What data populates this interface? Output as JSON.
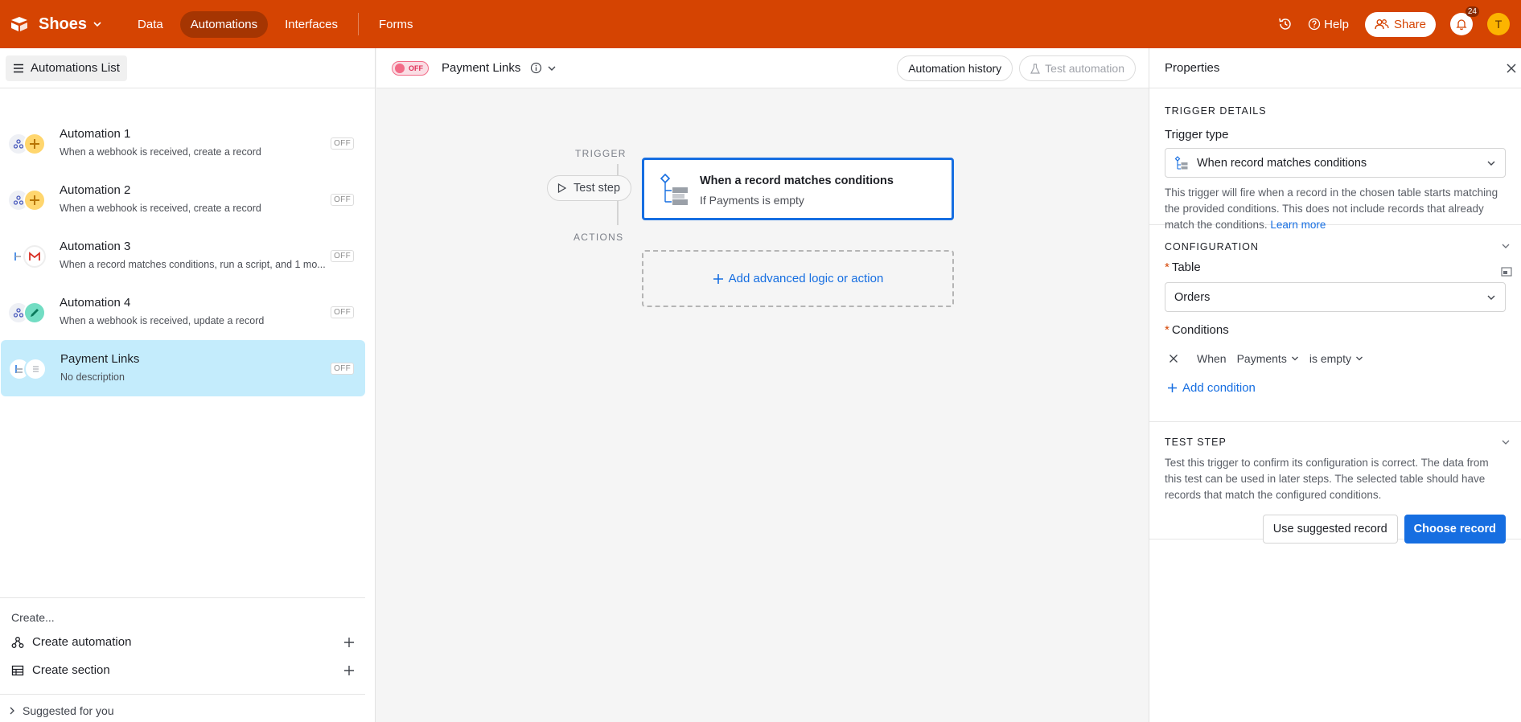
{
  "topbar": {
    "base_name": "Shoes",
    "nav": [
      "Data",
      "Automations",
      "Interfaces",
      "Forms"
    ],
    "active_nav": "Automations",
    "help": "Help",
    "share": "Share",
    "notifications": "24",
    "avatar_initial": "T",
    "colors": {
      "bar": "#d54402",
      "active_pill": "#a53502"
    }
  },
  "sidebar": {
    "list_button": "Automations List",
    "automations": [
      {
        "name": "Automation 1",
        "description": "When a webhook is received, create a record",
        "status": "OFF",
        "icon_a": "webhook-icon",
        "icon_b": "plus-icon",
        "selected": false
      },
      {
        "name": "Automation 2",
        "description": "When a webhook is received, create a record",
        "status": "OFF",
        "icon_a": "webhook-icon",
        "icon_b": "plus-icon",
        "selected": false
      },
      {
        "name": "Automation 3",
        "description": "When a record matches conditions, run a script, and 1 mo...",
        "status": "OFF",
        "icon_a": "trigger-icon",
        "icon_b": "gmail-icon",
        "selected": false
      },
      {
        "name": "Automation 4",
        "description": "When a webhook is received, update a record",
        "status": "OFF",
        "icon_a": "webhook-icon",
        "icon_b": "pencil-icon",
        "selected": false
      },
      {
        "name": "Payment Links",
        "description": "No description",
        "status": "OFF",
        "icon_a": "trigger-icon",
        "icon_b": "list-icon",
        "selected": true
      }
    ],
    "create_label": "Create...",
    "create_automation": "Create automation",
    "create_section": "Create section",
    "suggested": "Suggested for you"
  },
  "canvas": {
    "toggle": "OFF",
    "title": "Payment Links",
    "automation_history": "Automation history",
    "test_automation": "Test automation",
    "trigger_label": "TRIGGER",
    "actions_label": "ACTIONS",
    "test_step": "Test step",
    "trigger_title": "When a record matches conditions",
    "trigger_sub": "If Payments is empty",
    "add_action": "Add advanced logic or action"
  },
  "properties": {
    "title": "Properties",
    "trigger_details": "TRIGGER DETAILS",
    "trigger_type_label": "Trigger type",
    "trigger_type_value": "When record matches conditions",
    "trigger_help": "This trigger will fire when a record in the chosen table starts matching the provided conditions. This does not include records that already match the conditions.",
    "learn_more": "Learn more",
    "configuration": "CONFIGURATION",
    "table_label": "Table",
    "table_value": "Orders",
    "conditions_label": "Conditions",
    "condition": {
      "when": "When",
      "field": "Payments",
      "operator": "is empty"
    },
    "add_condition": "Add condition",
    "test_step": "TEST STEP",
    "test_help": "Test this trigger to confirm its configuration is correct. The data from this test can be used in later steps. The selected table should have records that match the configured conditions.",
    "use_suggested": "Use suggested record",
    "choose_record": "Choose record"
  }
}
